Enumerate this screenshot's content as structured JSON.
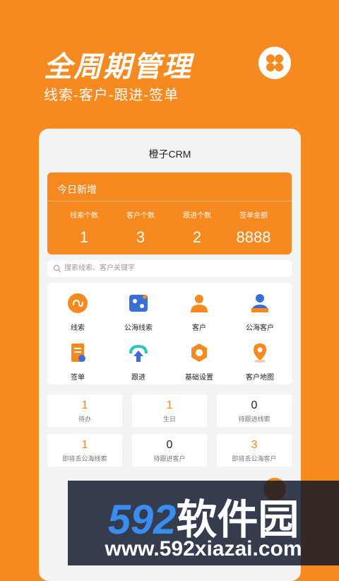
{
  "hero": {
    "title": "全周期管理",
    "subtitle": "线索-客户-跟进-签单"
  },
  "app": {
    "title": "橙子CRM",
    "today": {
      "title": "今日新增",
      "stats": [
        {
          "label": "线索个数",
          "value": "1"
        },
        {
          "label": "客户个数",
          "value": "3"
        },
        {
          "label": "跟进个数",
          "value": "2"
        },
        {
          "label": "签单金额",
          "value": "8888"
        }
      ]
    },
    "search": {
      "placeholder": "搜索线索、客户关键字"
    },
    "menu": [
      {
        "label": "线索",
        "icon": "lead-icon"
      },
      {
        "label": "公海线索",
        "icon": "sea-lead-icon"
      },
      {
        "label": "客户",
        "icon": "customer-icon"
      },
      {
        "label": "公海客户",
        "icon": "sea-customer-icon"
      },
      {
        "label": "签单",
        "icon": "contract-icon"
      },
      {
        "label": "跟进",
        "icon": "follow-icon"
      },
      {
        "label": "基础设置",
        "icon": "settings-icon"
      },
      {
        "label": "客户地图",
        "icon": "map-pin-icon"
      }
    ],
    "tasks": [
      {
        "value": "1",
        "label": "待办",
        "color": "orange"
      },
      {
        "value": "1",
        "label": "生日",
        "color": "orange"
      },
      {
        "value": "0",
        "label": "待跟进线索",
        "color": "black"
      },
      {
        "value": "1",
        "label": "即将丢公海线索",
        "color": "orange"
      },
      {
        "value": "0",
        "label": "待跟进客户",
        "color": "black"
      },
      {
        "value": "3",
        "label": "即将丢公海客户",
        "color": "orange"
      }
    ]
  },
  "watermark": {
    "brand_num": "592",
    "brand_cn": "软件园",
    "url": "www.592xiazai.com"
  },
  "colors": {
    "accent": "#f6891f",
    "blue": "#3a6fd8"
  }
}
